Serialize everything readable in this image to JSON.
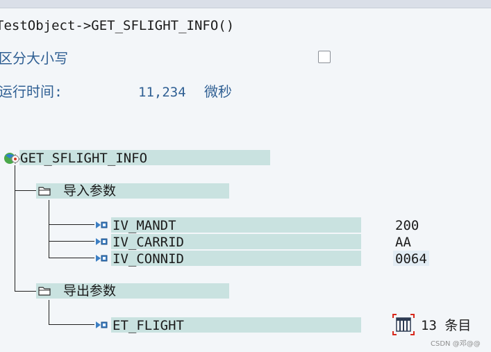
{
  "header": {
    "title": "TestObject->GET_SFLIGHT_INFO()"
  },
  "case": {
    "label": "区分大小写",
    "checked": false
  },
  "runtime": {
    "label": "运行时间:",
    "value": "11,234",
    "unit": "微秒"
  },
  "tree": {
    "root": {
      "label": "GET_SFLIGHT_INFO",
      "icon": "method-gear-icon"
    },
    "import": {
      "label": "导入参数",
      "params": [
        {
          "name": "IV_MANDT",
          "value": "200"
        },
        {
          "name": "IV_CARRID",
          "value": "AA"
        },
        {
          "name": "IV_CONNID",
          "value": "0064"
        }
      ]
    },
    "export": {
      "label": "导出参数",
      "params": [
        {
          "name": "ET_FLIGHT",
          "value": "13 条目",
          "icon": "table-icon"
        }
      ]
    }
  },
  "footer": {
    "watermark": "CSDN @邓@@"
  }
}
